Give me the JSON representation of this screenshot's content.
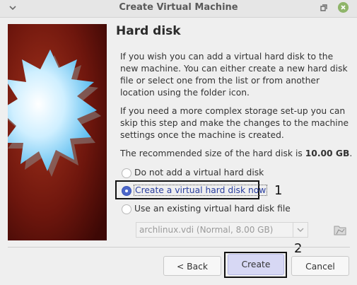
{
  "window": {
    "title": "Create Virtual Machine"
  },
  "page": {
    "heading": "Hard disk",
    "paragraph_1": "If you wish you can add a virtual hard disk to the new machine. You can either create a new hard disk file or select one from the list or from another location using the folder icon.",
    "paragraph_2": "If you need a more complex storage set-up you can skip this step and make the changes to the machine settings once the machine is created.",
    "recommended_prefix": "The recommended size of the hard disk is ",
    "recommended_size": "10.00 GB",
    "recommended_suffix": "."
  },
  "options": [
    {
      "label": "Do not add a virtual hard disk",
      "checked": false
    },
    {
      "label": "Create a virtual hard disk now",
      "checked": true
    },
    {
      "label": "Use an existing virtual hard disk file",
      "checked": false
    }
  ],
  "disk_select": {
    "value": "archlinux.vdi (Normal, 8.00 GB)",
    "enabled": false
  },
  "annotations": {
    "marker_1": "1",
    "marker_2": "2"
  },
  "buttons": {
    "back": "< Back",
    "create": "Create",
    "cancel": "Cancel"
  },
  "icons": {
    "menu": "chevron-down-icon",
    "restore": "restore-icon",
    "close": "close-icon",
    "folder": "folder-icon"
  },
  "colors": {
    "accent": "#4c67c9",
    "close_button": "#8fb56a",
    "side_panel": "#7a1b10",
    "create_highlight": "#d7d8f4"
  }
}
